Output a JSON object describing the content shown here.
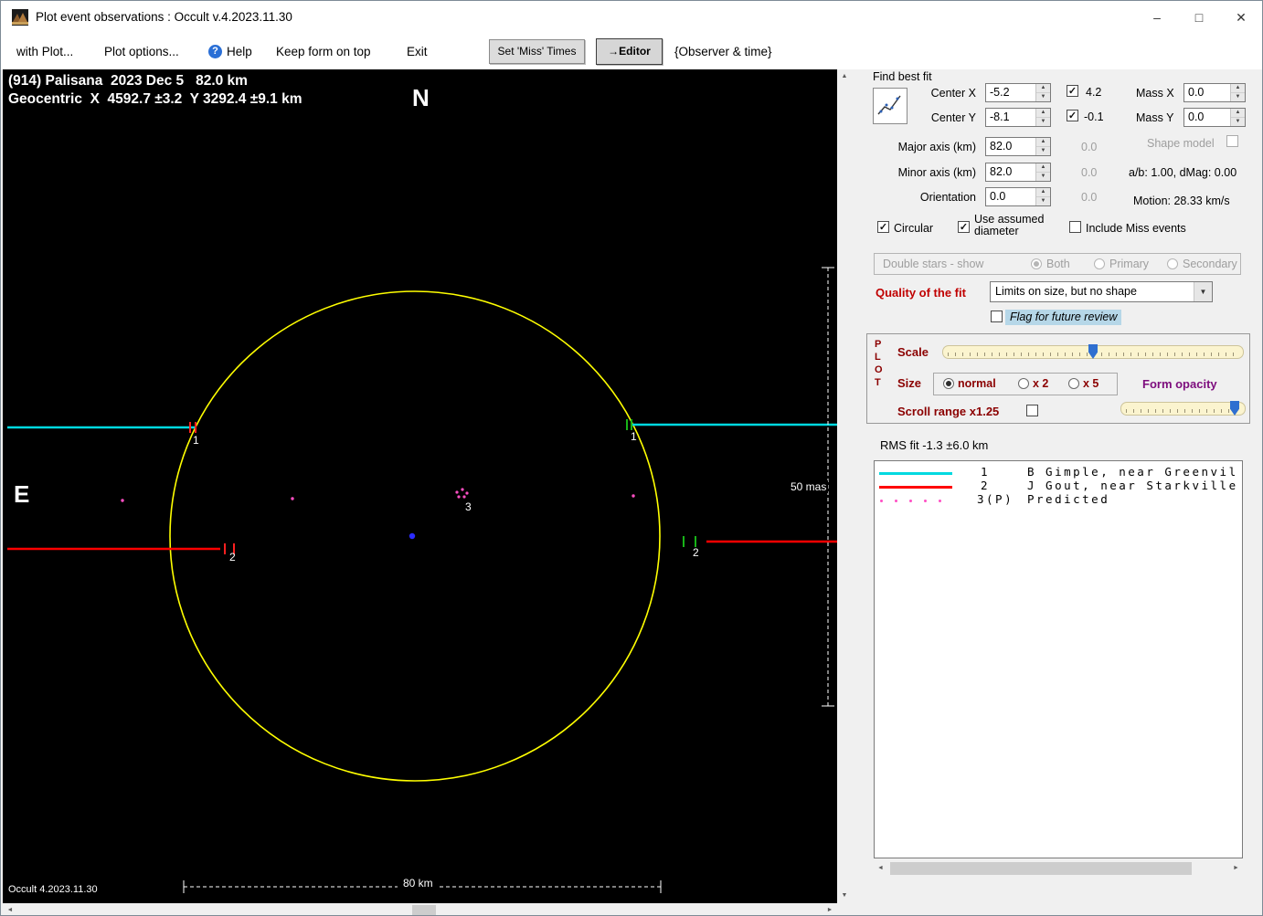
{
  "icons": {
    "help": "?",
    "minimize": "–",
    "maximize": "□",
    "close": "✕",
    "check": "✓",
    "spin_up": "▲",
    "spin_down": "▼",
    "dropdown": "▼",
    "scroll_up": "▲",
    "scroll_down": "▼",
    "scroll_left": "◄",
    "scroll_right": "►"
  },
  "window": {
    "title": "Plot event observations : Occult v.4.2023.11.30"
  },
  "menubar": {
    "with_plot": "with Plot...",
    "plot_options": "Plot options...",
    "help": "Help",
    "keep_form_on_top": "Keep form on top",
    "exit": "Exit",
    "set_miss_times": "Set 'Miss' Times",
    "editor": "→Editor",
    "observer_time": "{Observer & time}"
  },
  "plot": {
    "header_line1": "(914) Palisana  2023 Dec 5   82.0 km",
    "header_line2": "Geocentric  X  4592.7 ±3.2  Y 3292.4 ±9.1 km",
    "north": "N",
    "east": "E",
    "chord1": "1",
    "chord2": "2",
    "chord3": "3",
    "mas_scale": "50 mas",
    "km_scale": "80 km",
    "version": "Occult 4.2023.11.30"
  },
  "find_best_fit": {
    "title": "Find best fit",
    "center_x": {
      "label": "Center X",
      "value": "-5.2",
      "error": "4.2"
    },
    "center_y": {
      "label": "Center Y",
      "value": "-8.1",
      "error": "-0.1"
    },
    "mass_x": {
      "label": "Mass X",
      "value": "0.0"
    },
    "mass_y": {
      "label": "Mass Y",
      "value": "0.0"
    },
    "major_axis": {
      "label": "Major axis (km)",
      "value": "82.0",
      "error": "0.0"
    },
    "minor_axis": {
      "label": "Minor axis (km)",
      "value": "82.0",
      "error": "0.0"
    },
    "orientation": {
      "label": "Orientation",
      "value": "0.0",
      "error": "0.0"
    },
    "shape_model": "Shape model",
    "ab_dmag": "a/b: 1.00, dMag: 0.00",
    "motion": "Motion: 28.33 km/s",
    "circular": "Circular",
    "use_assumed_line1": "Use assumed",
    "use_assumed_line2": "diameter",
    "include_miss": "Include Miss events"
  },
  "double_stars": {
    "title": "Double stars - show",
    "both": "Both",
    "primary": "Primary",
    "secondary": "Secondary"
  },
  "quality": {
    "label": "Quality of the fit",
    "selected": "Limits on size, but no shape",
    "flag": "Flag for future review"
  },
  "plot_controls": {
    "letters": [
      "P",
      "L",
      "O",
      "T"
    ],
    "scale": "Scale",
    "size": "Size",
    "size_options": [
      "normal",
      "x 2",
      "x 5"
    ],
    "form_opacity": "Form opacity",
    "scroll_range": "Scroll range x1.25"
  },
  "rms": "RMS fit -1.3 ±6.0 km",
  "legend": [
    {
      "num": "1",
      "name": "B Gimple, near Greenvil"
    },
    {
      "num": "2",
      "name": "J Gout, near Starkville"
    },
    {
      "num": "3(P)",
      "name": "Predicted"
    }
  ],
  "colors": {
    "circle": "#ffff00",
    "chord1": "#00d9e0",
    "chord2": "#ff0000",
    "predicted": "#ff4fc4",
    "center_mark": "#2b2bff"
  }
}
